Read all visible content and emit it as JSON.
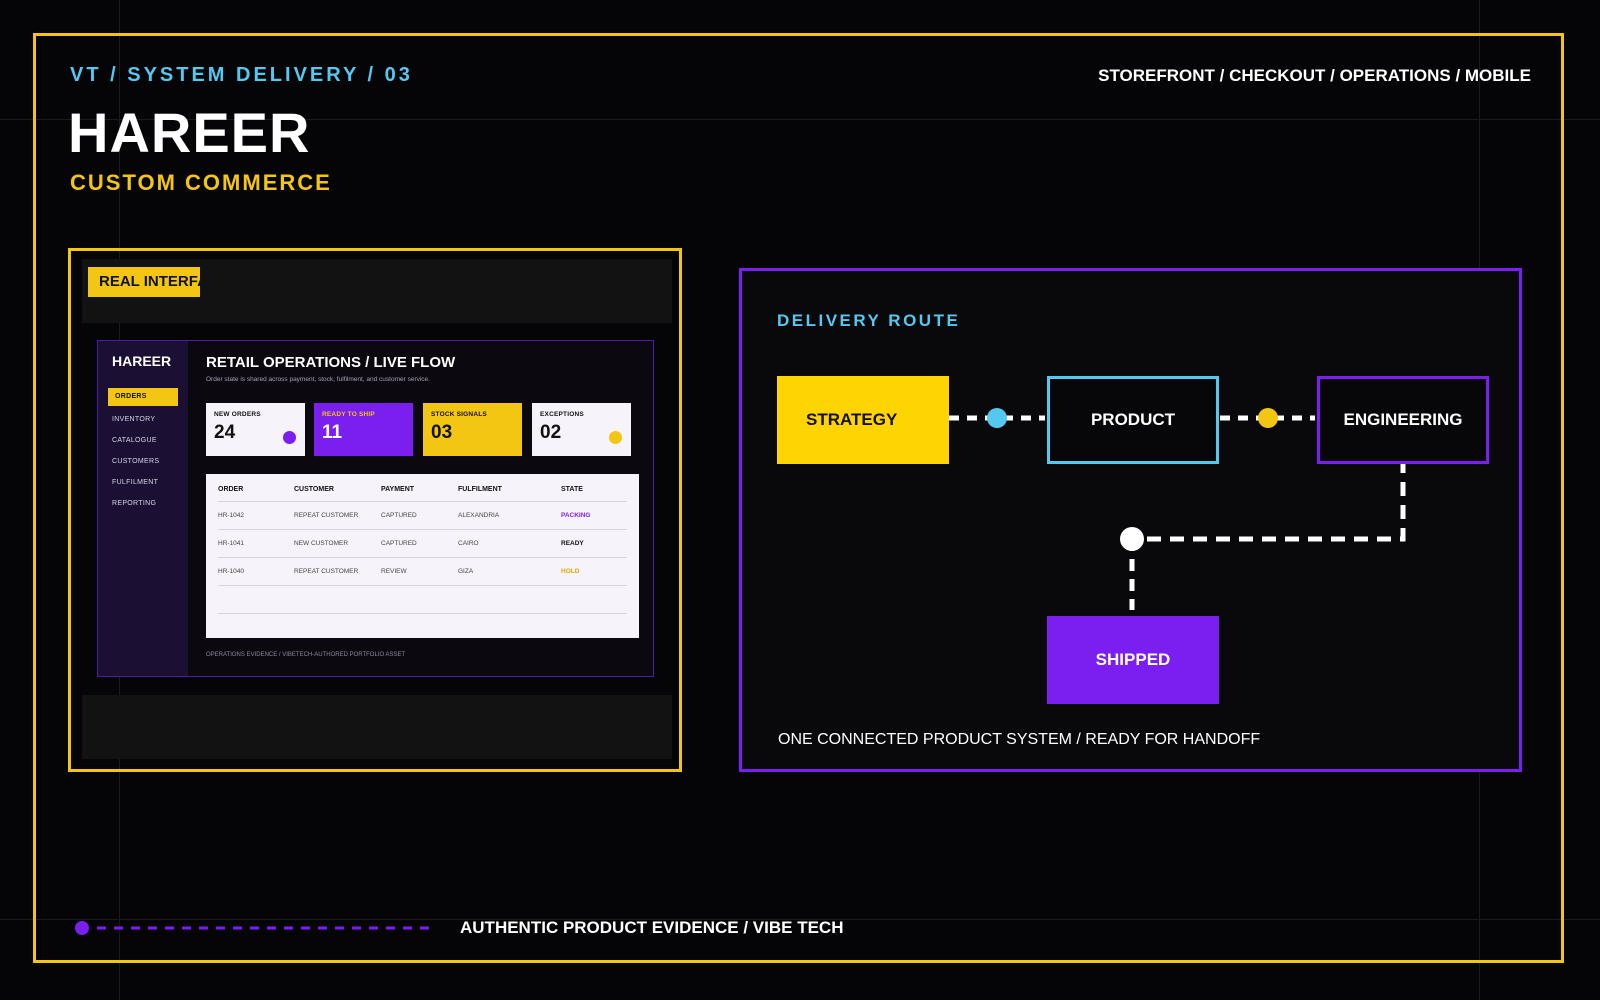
{
  "header": {
    "eyebrow": "VT / SYSTEM DELIVERY / 03",
    "brand": "HAREER",
    "subtitle": "CUSTOM COMMERCE",
    "scope": "STOREFRONT / CHECKOUT / OPERATIONS / MOBILE"
  },
  "evidence": {
    "chip": "REAL INTERFACE",
    "app": {
      "logo": "HAREER",
      "nav": [
        "ORDERS",
        "INVENTORY",
        "CATALOGUE",
        "CUSTOMERS",
        "FULFILMENT",
        "REPORTING"
      ],
      "active_nav": "ORDERS",
      "title": "RETAIL OPERATIONS / LIVE FLOW",
      "description": "Order state is shared across payment, stock, fulfilment, and customer service.",
      "stats": [
        {
          "label": "NEW ORDERS",
          "value": "24"
        },
        {
          "label": "READY TO SHIP",
          "value": "11"
        },
        {
          "label": "STOCK SIGNALS",
          "value": "03"
        },
        {
          "label": "EXCEPTIONS",
          "value": "02"
        }
      ],
      "table": {
        "columns": [
          "ORDER",
          "CUSTOMER",
          "PAYMENT",
          "FULFILMENT",
          "STATE"
        ],
        "rows": [
          [
            "HR-1042",
            "REPEAT CUSTOMER",
            "CAPTURED",
            "ALEXANDRIA",
            "PACKING"
          ],
          [
            "HR-1041",
            "NEW CUSTOMER",
            "CAPTURED",
            "CAIRO",
            "READY"
          ],
          [
            "HR-1040",
            "REPEAT CUSTOMER",
            "REVIEW",
            "GIZA",
            "HOLD"
          ]
        ]
      },
      "footer": "OPERATIONS EVIDENCE / VIBETECH-AUTHORED PORTFOLIO ASSET"
    }
  },
  "route": {
    "title": "DELIVERY ROUTE",
    "nodes": {
      "strategy": "STRATEGY",
      "product": "PRODUCT",
      "engineering": "ENGINEERING",
      "shipped": "SHIPPED"
    },
    "footer": "ONE CONNECTED PRODUCT SYSTEM / READY FOR HANDOFF"
  },
  "footer": {
    "text": "AUTHENTIC PRODUCT EVIDENCE / VIBE TECH"
  },
  "colors": {
    "yellow": "#f3c613",
    "purple": "#7a1ff0",
    "cyan": "#55c8f0",
    "background": "#050507"
  }
}
